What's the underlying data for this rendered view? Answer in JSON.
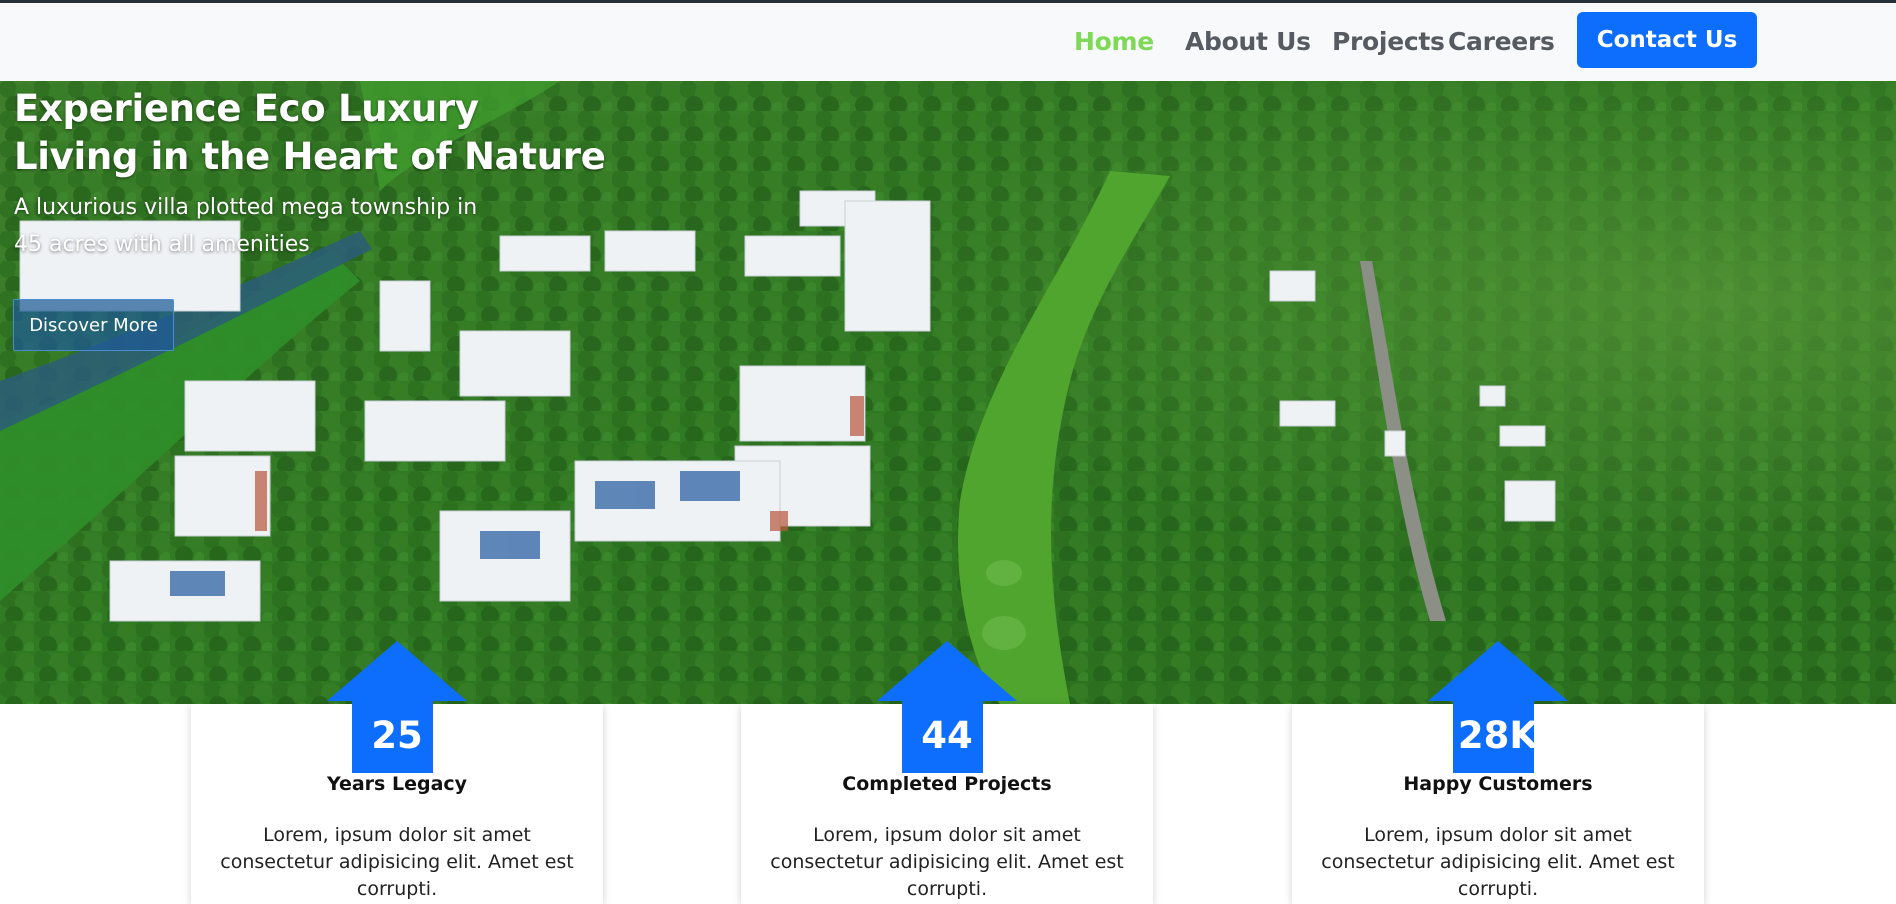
{
  "nav": {
    "items": [
      {
        "label": "Home",
        "active": true
      },
      {
        "label": "About Us",
        "active": false
      },
      {
        "label": "Projects",
        "active": false
      },
      {
        "label": "Careers",
        "active": false
      }
    ],
    "contact_label": "Contact Us",
    "active_color": "#7ed957",
    "contact_color": "#0d6efd"
  },
  "hero": {
    "title_line1": "Experience Eco Luxury",
    "title_line2": "Living in the Heart of Nature",
    "subtitle": "A luxurious villa plotted mega township in 45 acres with all amenities",
    "button_label": "Discover More",
    "image": "aerial-eco-township-photo"
  },
  "stats": [
    {
      "value": "25",
      "label": "Years Legacy",
      "description": "Lorem, ipsum dolor sit amet consectetur adipisicing elit. Amet est corrupti."
    },
    {
      "value": "44",
      "label": "Completed Projects",
      "description": "Lorem, ipsum dolor sit amet consectetur adipisicing elit. Amet est corrupti."
    },
    {
      "value": "28K",
      "label": "Happy Customers",
      "description": "Lorem, ipsum dolor sit amet consectetur adipisicing elit. Amet est corrupti."
    }
  ],
  "accent_color": "#0d6efd"
}
